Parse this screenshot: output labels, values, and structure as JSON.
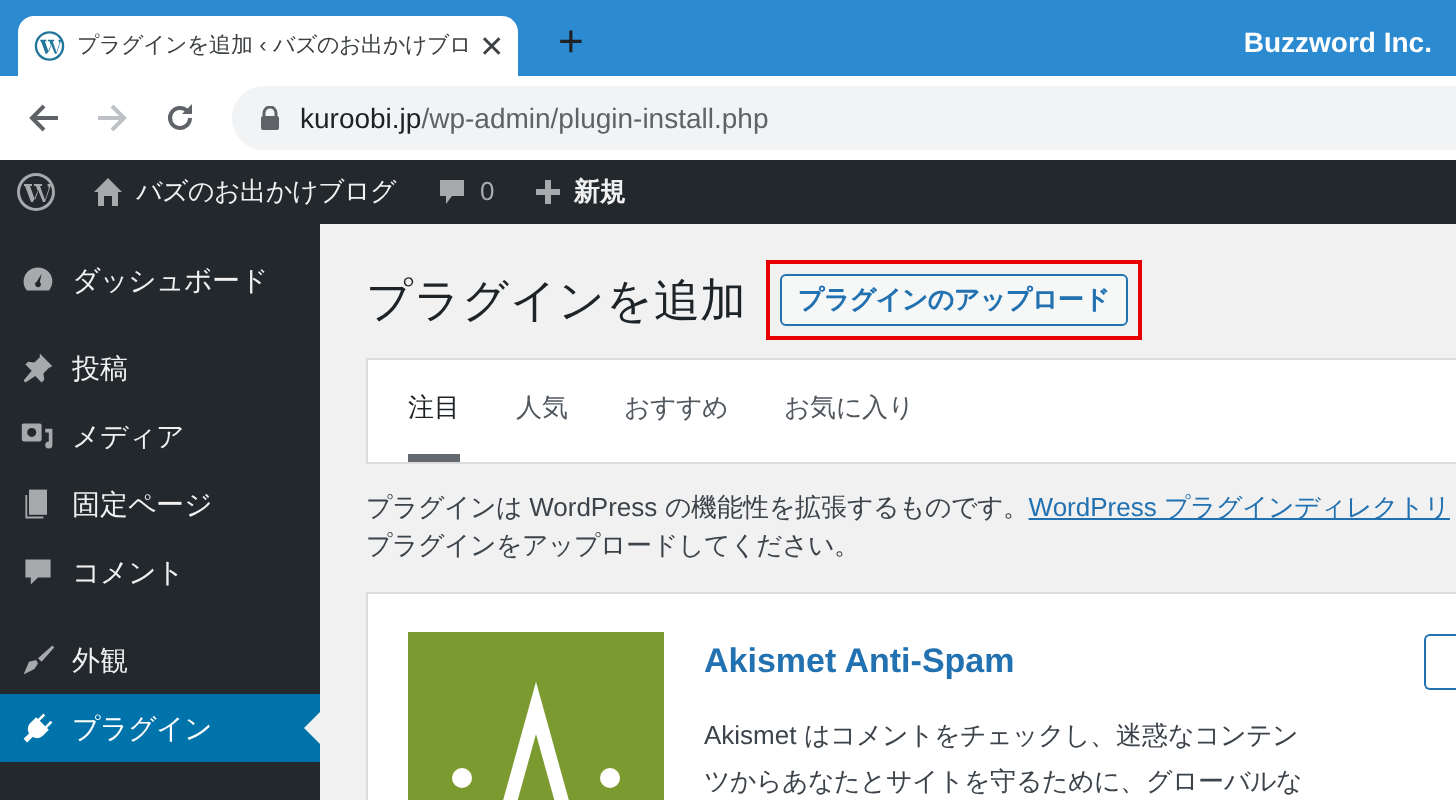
{
  "browser": {
    "tab_title": "プラグインを追加 ‹ バズのお出かけブロ",
    "new_tab": "+",
    "profile": "Buzzword Inc.",
    "url_domain": "kuroobi.jp",
    "url_path": "/wp-admin/plugin-install.php"
  },
  "admin_bar": {
    "site_name": "バズのお出かけブログ",
    "comments": "0",
    "new": "新規"
  },
  "sidebar": {
    "items": [
      {
        "label": "ダッシュボード",
        "selected": false
      },
      {
        "label": "投稿",
        "selected": false
      },
      {
        "label": "メディア",
        "selected": false
      },
      {
        "label": "固定ページ",
        "selected": false
      },
      {
        "label": "コメント",
        "selected": false
      },
      {
        "label": "外観",
        "selected": false
      },
      {
        "label": "プラグイン",
        "selected": true
      }
    ]
  },
  "page": {
    "title": "プラグインを追加",
    "upload_button": "プラグインのアップロード",
    "upload_highlighted": true
  },
  "tabs": [
    {
      "label": "注目",
      "selected": true
    },
    {
      "label": "人気",
      "selected": false
    },
    {
      "label": "おすすめ",
      "selected": false
    },
    {
      "label": "お気に入り",
      "selected": false
    }
  ],
  "description": {
    "before": "プラグインは WordPress の機能性を拡張するものです。",
    "link": "WordPress プラグインディレクトリ",
    "line2": "プラグインをアップロードしてください。"
  },
  "plugin_card": {
    "title": "Akismet Anti-Spam",
    "description": [
      "Akismet はコメントをチェックし、迷惑なコンテン",
      "ツからあなたとサイトを守るために、グローバルな"
    ]
  }
}
